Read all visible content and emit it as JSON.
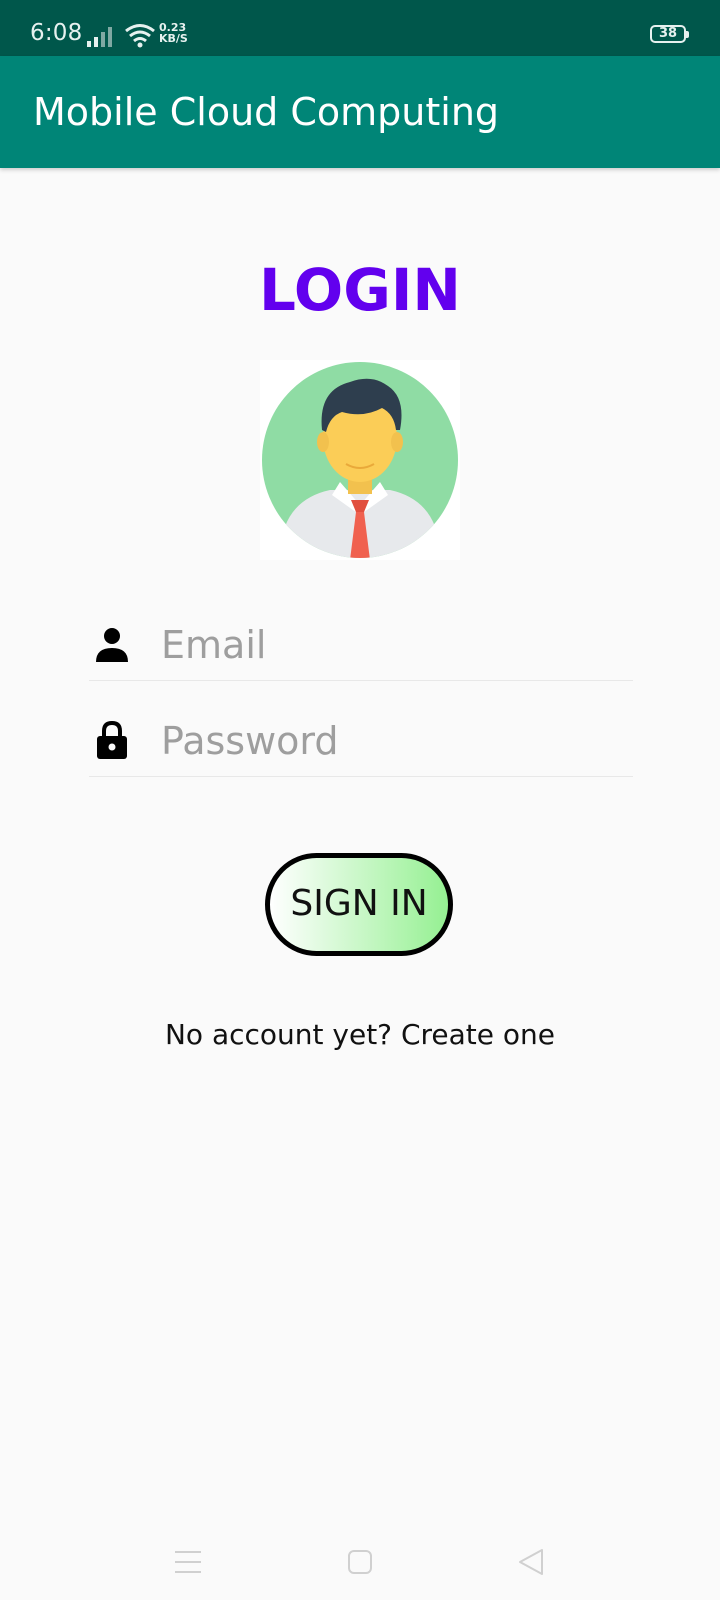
{
  "status_bar": {
    "time": "6:08",
    "net_speed_value": "0.23",
    "net_speed_unit": "KB/S",
    "battery_level": "38",
    "icons": [
      "signal-icon",
      "wifi-icon",
      "battery-icon"
    ]
  },
  "app_bar": {
    "title": "Mobile Cloud Computing"
  },
  "login": {
    "heading": "LOGIN",
    "email_placeholder": "Email",
    "password_placeholder": "Password",
    "signin_label": "SIGN IN",
    "create_account_text": "No account yet? Create one"
  },
  "colors": {
    "status_bar": "#00574b",
    "app_bar": "#008577",
    "heading": "#6200ee",
    "button_gradient_end": "#95f092"
  },
  "nav_bar": {
    "icons": [
      "menu-icon",
      "home-icon",
      "back-icon"
    ]
  }
}
